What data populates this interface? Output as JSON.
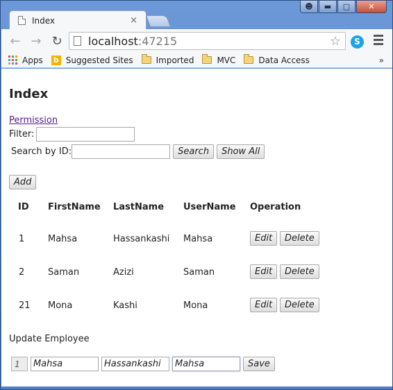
{
  "window": {
    "buttons": [
      "user",
      "minimize",
      "maximize",
      "close"
    ]
  },
  "tab": {
    "title": "Index",
    "close_glyph": "×"
  },
  "toolbar": {
    "url_host": "localhost",
    "url_port": ":47215"
  },
  "bookmarks": [
    {
      "label": "Apps",
      "icon": "apps-grid-icon"
    },
    {
      "label": "Suggested Sites",
      "icon": "bing-icon"
    },
    {
      "label": "Imported",
      "icon": "folder-icon"
    },
    {
      "label": "MVC",
      "icon": "folder-icon"
    },
    {
      "label": "Data Access",
      "icon": "folder-icon"
    }
  ],
  "page": {
    "title": "Index",
    "permission_link": "Permission",
    "filter_label": "Filter:",
    "filter_value": "",
    "search_label": "Search by ID:",
    "search_value": "",
    "search_button": "Search",
    "show_all_button": "Show All",
    "add_button": "Add",
    "columns": [
      "ID",
      "FirstName",
      "LastName",
      "UserName",
      "Operation"
    ],
    "rows": [
      {
        "id": "1",
        "first": "Mahsa",
        "last": "Hassankashi",
        "user": "Mahsa"
      },
      {
        "id": "2",
        "first": "Saman",
        "last": "Azizi",
        "user": "Saman"
      },
      {
        "id": "21",
        "first": "Mona",
        "last": "Kashi",
        "user": "Mona"
      }
    ],
    "edit_label": "Edit",
    "delete_label": "Delete",
    "update_title": "Update Employee",
    "update": {
      "id": "1",
      "first": "Mahsa",
      "last": "Hassankashi",
      "user": "Mahsa",
      "save_button": "Save"
    }
  }
}
